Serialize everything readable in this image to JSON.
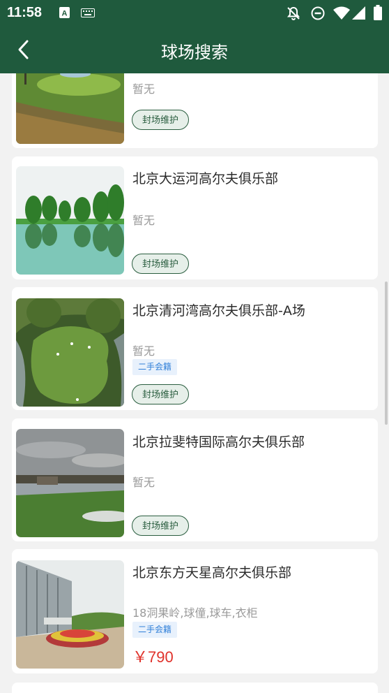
{
  "status_bar": {
    "time": "11:58",
    "icons": [
      "a-notification-icon",
      "keyboard-icon",
      "bell-off-icon",
      "do-not-disturb-icon",
      "wifi-icon",
      "signal-icon",
      "battery-icon"
    ]
  },
  "header": {
    "title": "球场搜索",
    "back_icon": "chevron-left-icon"
  },
  "colors": {
    "primary": "#1f5a3d",
    "price": "#e0322b",
    "tag_text": "#2f7fd8",
    "tag_bg": "#e8f1fc"
  },
  "courses": [
    {
      "name": "",
      "desc": "暂无",
      "tag": "",
      "status": "封场维护",
      "price": ""
    },
    {
      "name": "北京大运河高尔夫俱乐部",
      "desc": "暂无",
      "tag": "",
      "status": "封场维护",
      "price": ""
    },
    {
      "name": "北京清河湾高尔夫俱乐部-A场",
      "desc": "暂无",
      "tag": "二手会籍",
      "status": "封场维护",
      "price": ""
    },
    {
      "name": "北京拉斐特国际高尔夫俱乐部",
      "desc": "暂无",
      "tag": "",
      "status": "封场维护",
      "price": ""
    },
    {
      "name": "北京东方天星高尔夫俱乐部",
      "desc": "18洞果岭,球僮,球车,衣柜",
      "tag": "二手会籍",
      "status": "",
      "price": "￥790"
    }
  ]
}
